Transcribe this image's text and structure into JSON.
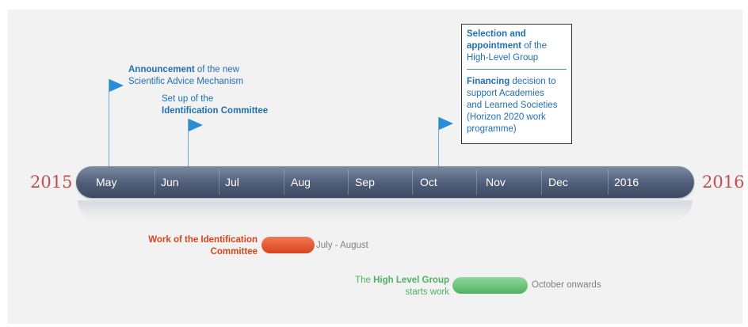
{
  "years": {
    "start": "2015",
    "end": "2016"
  },
  "months": [
    "May",
    "Jun",
    "Jul",
    "Aug",
    "Sep",
    "Oct",
    "Nov",
    "Dec",
    "2016"
  ],
  "milestones": {
    "announcement": {
      "bold": "Announcement",
      "text1": " of the new",
      "text2": "Scientific Advice Mechanism"
    },
    "setup": {
      "line1": "Set up of the",
      "bold": "Identification Committee"
    },
    "selection": {
      "bold1": "Selection and",
      "bold2": "appointment",
      "text1": " of the",
      "text2": "High-Level Group"
    },
    "financing": {
      "bold": "Financing",
      "text1": " decision to",
      "line2": "support Academies",
      "line3": "and Learned Societies",
      "line4": "(Horizon 2020 work",
      "line5": "programme)"
    }
  },
  "periods": {
    "identification": {
      "line1": "Work of the Identification",
      "line2": "Committee",
      "range": "July - August",
      "color": "#d8431c"
    },
    "hlg": {
      "prefix": "The ",
      "bold": "High Level Group",
      "line2": "starts work",
      "range": "October onwards",
      "color": "#4fb262"
    }
  }
}
